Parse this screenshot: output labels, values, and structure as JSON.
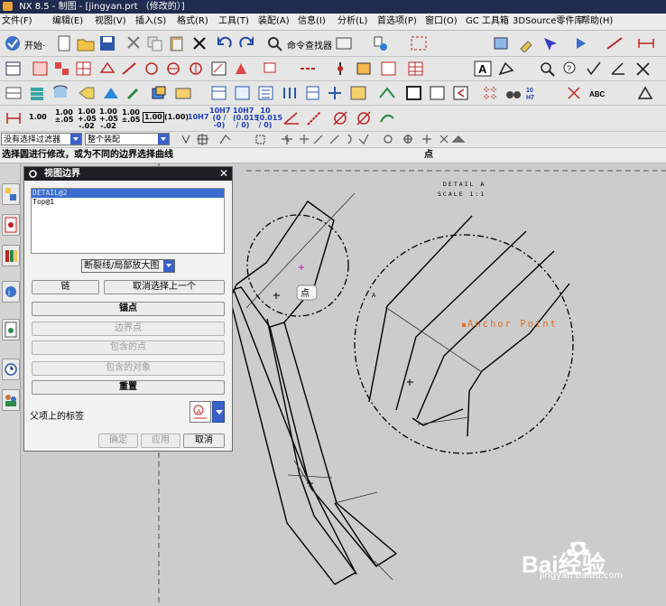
{
  "window": {
    "title": "NX 8.5 - 制图 - [jingyan.prt （修改的）]"
  },
  "menu": [
    "文件(F)",
    "编辑(E)",
    "视图(V)",
    "插入(S)",
    "格式(R)",
    "工具(T)",
    "装配(A)",
    "信息(I)",
    "分析(L)",
    "首选项(P)",
    "窗口(O)",
    "GC 工具箱",
    "3DSource零件库",
    "帮助(H)"
  ],
  "toolbar": {
    "start_label": "开始·",
    "command_finder_label": "命令查找器"
  },
  "tolerance_labels": [
    "1.00",
    "1.00 ±.05",
    "1.00 +.05 -.02",
    "1.00 +.05 -.02",
    "1.00 ±.05",
    "1.00",
    "(1.00)",
    "10H7",
    "10H7 (0 / -0)",
    "10H7 (0.015 / 0)",
    "10 (0.015 / 0)"
  ],
  "selection_bar": {
    "filter_value": "没有选择过滤器",
    "scope_value": "整个装配"
  },
  "cue": {
    "text": "选择圆进行修改，或为不同的边界选择曲线",
    "status": "点"
  },
  "dialog": {
    "title": "视图边界",
    "view_list": [
      "DETAIL@2",
      "Top@1"
    ],
    "selected_index": 0,
    "boundary_type": "断裂线/局部放大图",
    "chain_btn": "链",
    "deselect_prev_btn": "取消选择上一个",
    "anchor_btn": "锚点",
    "boundary_point_btn": "边界点",
    "included_points_btn": "包含的点",
    "included_objects_btn": "包含的对象",
    "reset_btn": "重置",
    "parent_label_text": "父项上的标签",
    "ok_btn": "确定",
    "apply_btn": "应用",
    "cancel_btn": "取消"
  },
  "drawing": {
    "detail_title": "DETAIL A",
    "detail_scale": "SCALE 1:1",
    "anchor_label": "Anchor Point",
    "snap_tooltip": "点",
    "small_label": "A"
  },
  "watermark": {
    "brand": "Bai经验",
    "url": "jingyan.baidu.com"
  },
  "colors": {
    "title_bar": "#1f2b4f",
    "dialog_title": "#1e1f22",
    "selection_highlight": "#3a6ccf",
    "anchor_text": "#e0702a",
    "dropdown_blue": "#3a61c8"
  }
}
